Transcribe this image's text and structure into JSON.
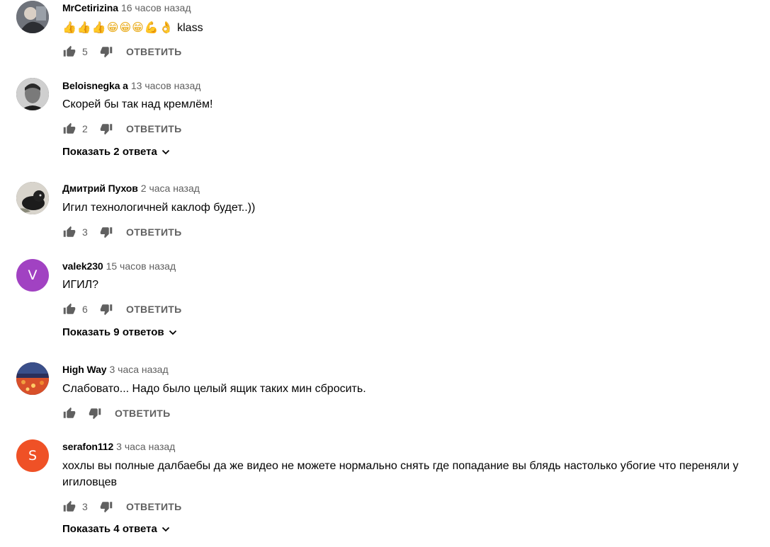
{
  "reply_label": "ОТВЕТИТЬ",
  "comments": [
    {
      "author": "MrCetirizina",
      "time": "16 часов назад",
      "text": "klass",
      "emoji": "👍👍👍😁😁😁💪👌",
      "likes": "5",
      "avatar_color": "#7d7f86"
    },
    {
      "author": "Beloisnegka a",
      "time": "13 часов назад",
      "text": "Скорей бы так над кремлём!",
      "likes": "2",
      "replies": "Показать 2 ответа",
      "avatar_color": "#3a3a3a"
    },
    {
      "author": "Дмитрий Пухов",
      "time": "2 часа назад",
      "text": "Игил технологичней каклоф будет..))",
      "likes": "3",
      "avatar_color": "#5c5a52"
    },
    {
      "author": "valek230",
      "time": "15 часов назад",
      "text": "ИГИЛ?",
      "likes": "6",
      "replies": "Показать 9 ответов",
      "avatar_letter": "V",
      "avatar_color": "#a142c2"
    },
    {
      "author": "High Way",
      "time": "3 часа назад",
      "text": "Слабовато... Надо было целый ящик таких мин сбросить.",
      "likes": "",
      "avatar_color": "#c2452b"
    },
    {
      "author": "serafon112",
      "time": "3 часа назад",
      "text": "хохлы вы полные далбаебы да же видео не можете нормально снять где попадание  вы блядь настолько убогие что переняли у игиловцев",
      "likes": "3",
      "replies": "Показать 4 ответа",
      "avatar_letter": "S",
      "avatar_color": "#ef5126"
    }
  ]
}
